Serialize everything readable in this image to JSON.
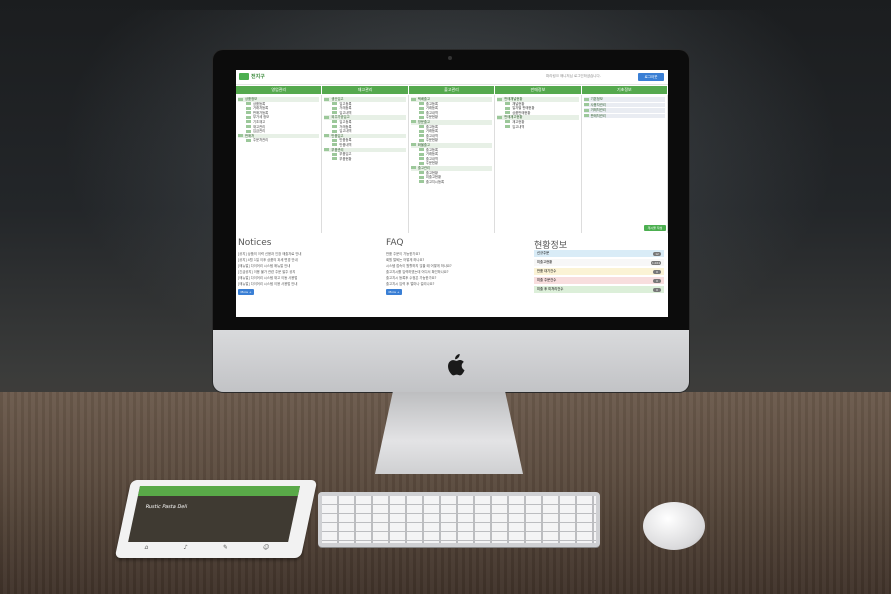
{
  "header": {
    "logo_text": "전지구",
    "welcome": "파리링크 매니저님 로그인하셨습니다.",
    "logout_label": "로그아웃"
  },
  "menu": {
    "tabs": [
      "영업관리",
      "재고관리",
      "출고관리",
      "판매정보",
      "기초정보"
    ]
  },
  "columns": [
    [
      {
        "label": "상품정보",
        "kind": "head"
      },
      {
        "label": "상품등록",
        "kind": "sub"
      },
      {
        "label": "거래처등록",
        "kind": "sub"
      },
      {
        "label": "판매가등록",
        "kind": "sub"
      },
      {
        "label": "부가세 정보",
        "kind": "sub"
      },
      {
        "label": "기초재고",
        "kind": "sub"
      },
      {
        "label": "재고관리",
        "kind": "sub"
      },
      {
        "label": "입금관리",
        "kind": "sub"
      },
      {
        "label": "판매처",
        "kind": "head"
      },
      {
        "label": "주문처관리",
        "kind": "sub"
      }
    ],
    [
      {
        "label": "생산입고",
        "kind": "head"
      },
      {
        "label": "입고등록",
        "kind": "sub"
      },
      {
        "label": "거래등록",
        "kind": "sub"
      },
      {
        "label": "입고내역",
        "kind": "sub"
      },
      {
        "label": "외주가공입고",
        "kind": "head"
      },
      {
        "label": "입고등록",
        "kind": "sub"
      },
      {
        "label": "거래등록",
        "kind": "sub"
      },
      {
        "label": "입고내역",
        "kind": "sub"
      },
      {
        "label": "반품입고",
        "kind": "head"
      },
      {
        "label": "반품등록",
        "kind": "sub"
      },
      {
        "label": "반품내역",
        "kind": "sub"
      },
      {
        "label": "부품관리",
        "kind": "head"
      },
      {
        "label": "부품입고",
        "kind": "sub"
      },
      {
        "label": "부품현황",
        "kind": "sub"
      }
    ],
    [
      {
        "label": "택배출고",
        "kind": "head"
      },
      {
        "label": "출고등록",
        "kind": "sub"
      },
      {
        "label": "거래등록",
        "kind": "sub"
      },
      {
        "label": "출고내역",
        "kind": "sub"
      },
      {
        "label": "주문현황",
        "kind": "sub"
      },
      {
        "label": "방문출고",
        "kind": "head"
      },
      {
        "label": "출고등록",
        "kind": "sub"
      },
      {
        "label": "거래등록",
        "kind": "sub"
      },
      {
        "label": "출고내역",
        "kind": "sub"
      },
      {
        "label": "주문현황",
        "kind": "sub"
      },
      {
        "label": "화물출고",
        "kind": "head"
      },
      {
        "label": "출고등록",
        "kind": "sub"
      },
      {
        "label": "거래등록",
        "kind": "sub"
      },
      {
        "label": "출고내역",
        "kind": "sub"
      },
      {
        "label": "주문현황",
        "kind": "sub"
      },
      {
        "label": "출고관리",
        "kind": "head"
      },
      {
        "label": "출고현황",
        "kind": "sub"
      },
      {
        "label": "미출고현황",
        "kind": "sub"
      },
      {
        "label": "출고지시등록",
        "kind": "sub"
      }
    ],
    [
      {
        "label": "판매채널현황",
        "kind": "head"
      },
      {
        "label": "채널현황",
        "kind": "sub"
      },
      {
        "label": "일자별 판매현황",
        "kind": "sub"
      },
      {
        "label": "상품판매현황",
        "kind": "sub"
      },
      {
        "label": "판매재고현황",
        "kind": "head"
      },
      {
        "label": "재고현황",
        "kind": "sub"
      },
      {
        "label": "입고내역",
        "kind": "sub"
      }
    ],
    [
      {
        "label": "기본정보",
        "kind": "head"
      },
      {
        "label": "사용자관리",
        "kind": "head"
      },
      {
        "label": "거래처관리",
        "kind": "head"
      },
      {
        "label": "판매처관리",
        "kind": "head"
      }
    ]
  ],
  "write_label": "게시물 작성",
  "notices": {
    "title": "Notices",
    "items": [
      "[공지] 상품의 이력 신용과 인장 매출자료 안내",
      "[공지] 4월 1일 이후 상품의 과세 변경 안내",
      "[매뉴얼] 다이어리 시스템 매뉴얼 안내",
      "[긴급공지] 이용 불가 관련 주문 발주 공지",
      "[매뉴얼] 다이어리 시스템 재고 이동 사용법",
      "[매뉴얼] 다이어리 시스템 이용 사용법 안내"
    ],
    "more": "More +"
  },
  "faq": {
    "title": "FAQ",
    "items": [
      "반품 주문이 가능한가요?",
      "회원 탈퇴는 어떻게 하나요?",
      "시스템 접속이 원활하지 않을 때 어떻게 하나요?",
      "출고지시를 입력하였는데 어디서 확인하나요?",
      "출고지시 등록후 수정은 가능한가요?",
      "출고지시 입력 후 얼마나 걸리나요?"
    ],
    "more": "More +"
  },
  "status": {
    "title": "현황정보",
    "items": [
      {
        "label": "신규주문",
        "value": "12",
        "color": "#d9ecf7"
      },
      {
        "label": "미출고현황",
        "value": "1,024",
        "color": "#f7f7f7"
      },
      {
        "label": "반품 대기건수",
        "value": "0",
        "color": "#fbf3d5"
      },
      {
        "label": "미출 주문건수",
        "value": "0",
        "color": "#f8dede"
      },
      {
        "label": "미출 후 미처리건수",
        "value": "0",
        "color": "#dcefd9"
      }
    ]
  },
  "tablet": {
    "headline": "Rustic Pasta Deli"
  },
  "colors": {
    "brand_green": "#55a94e",
    "button_blue": "#3a7fd5"
  },
  "icons": [
    "apple-logo-icon",
    "camera-icon",
    "logo-house-icon"
  ]
}
